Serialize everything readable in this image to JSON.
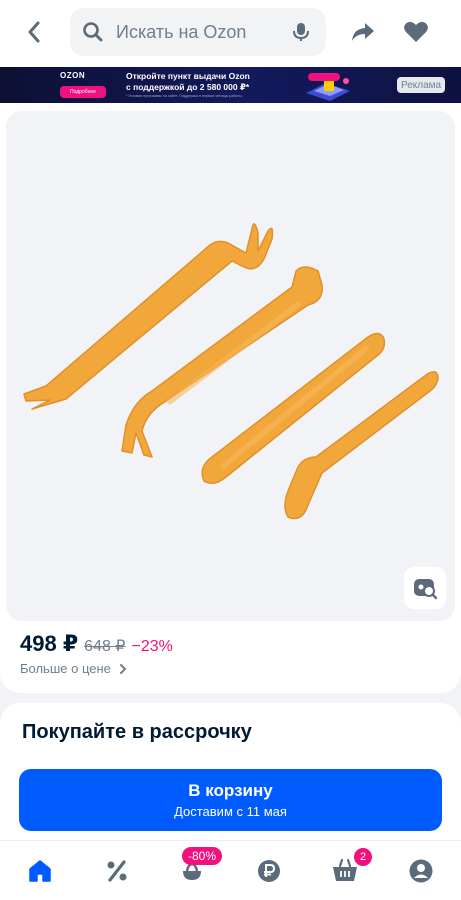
{
  "topbar": {
    "search_placeholder": "Искать на Ozon"
  },
  "ad": {
    "brand": "OZON",
    "more_label": "Подробнее",
    "headline_line1": "Откройте пункт выдачи Ozon",
    "headline_line2": "с поддержкой до 2 580 000 ₽*",
    "fine_print": "* Условия программы на сайте. Поддержка в первые месяцы работы.",
    "tag": "Реклама"
  },
  "product": {
    "price": "498 ₽",
    "old_price": "648 ₽",
    "discount": "−23%",
    "more_price_label": "Больше о цене",
    "tool_color": "#f2a73a"
  },
  "installment": {
    "title": "Покупайте в рассрочку"
  },
  "cart_button": {
    "label": "В корзину",
    "sub": "Доставим с 11 мая"
  },
  "bottom_nav": {
    "items": [
      {
        "icon": "home-icon",
        "active": true
      },
      {
        "icon": "percent-icon"
      },
      {
        "icon": "fresh-icon",
        "badge": "-80%"
      },
      {
        "icon": "ruble-icon"
      },
      {
        "icon": "cart-icon",
        "badge": "2"
      },
      {
        "icon": "profile-icon"
      }
    ],
    "sale_badge": "-80%",
    "cart_badge": "2"
  },
  "colors": {
    "accent": "#005bff",
    "badge": "#f1117e",
    "text": "#001a34",
    "muted": "#707f8d"
  }
}
